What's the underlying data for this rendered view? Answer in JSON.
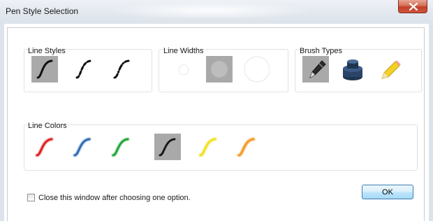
{
  "window": {
    "title": "Pen Style Selection"
  },
  "groups": {
    "line_styles": {
      "label": "Line Styles",
      "items": [
        "solid",
        "dashed",
        "dash-dot"
      ]
    },
    "line_widths": {
      "label": "Line Widths",
      "items": [
        "small",
        "medium",
        "large"
      ]
    },
    "brush_types": {
      "label": "Brush Types",
      "items": [
        "pen-icon",
        "ink-bottle-icon",
        "pencil-icon"
      ]
    },
    "line_colors": {
      "label": "Line Colors",
      "colors": [
        "#e02020",
        "#2f6bb3",
        "#22a33a",
        "#1a1a1a",
        "#f2e21c",
        "#f59a22"
      ]
    }
  },
  "close_option": {
    "label": "Close this window after choosing one option.",
    "checked": false
  },
  "ok_label": "OK",
  "accent": {
    "selected_tile": "#a9a9a9"
  }
}
